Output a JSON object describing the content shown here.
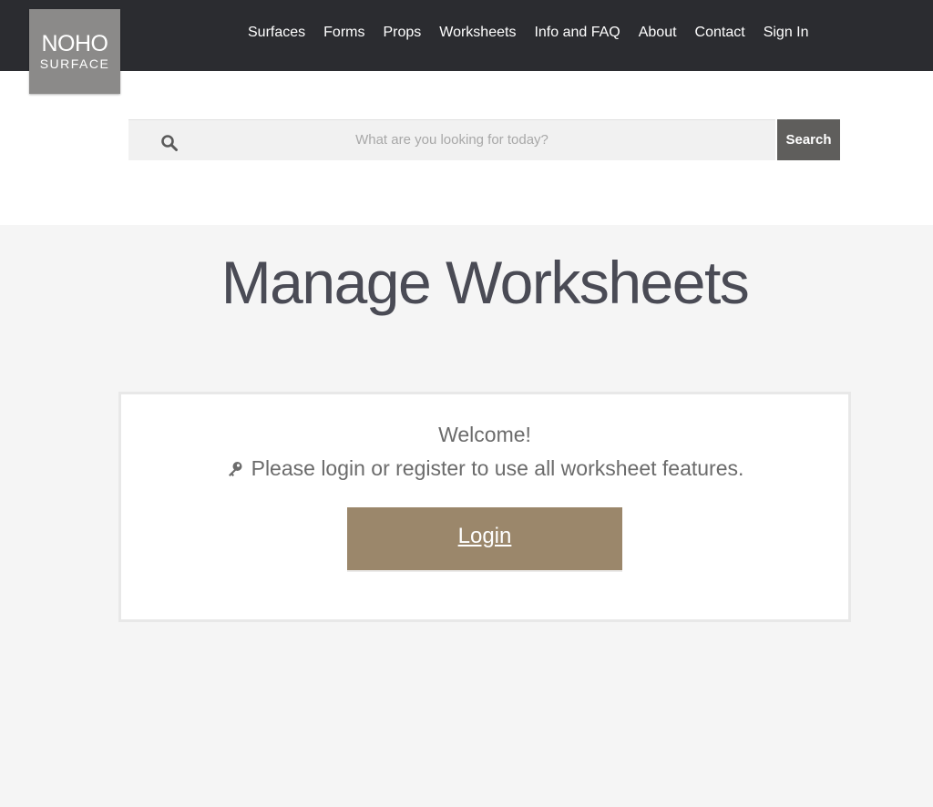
{
  "brand": {
    "logo_line1": "NOHO",
    "logo_line2": "SURFACE"
  },
  "nav": {
    "items": [
      {
        "label": "Surfaces"
      },
      {
        "label": "Forms"
      },
      {
        "label": "Props"
      },
      {
        "label": "Worksheets"
      },
      {
        "label": "Info and FAQ"
      },
      {
        "label": "About"
      },
      {
        "label": "Contact"
      },
      {
        "label": "Sign In"
      }
    ]
  },
  "search": {
    "placeholder": "What are you looking for today?",
    "value": "",
    "button_label": "Search",
    "icon": "search-icon"
  },
  "main": {
    "title": "Manage Worksheets",
    "welcome": "Welcome!",
    "message": "Please login or register to use all worksheet features.",
    "message_icon": "key-icon",
    "login_label": "Login"
  },
  "colors": {
    "topbar": "#2b2c30",
    "logo_bg": "#8b8a89",
    "search_button": "#5f5e5c",
    "login_button": "#9b876b",
    "page_bg": "#f5f5f5"
  }
}
